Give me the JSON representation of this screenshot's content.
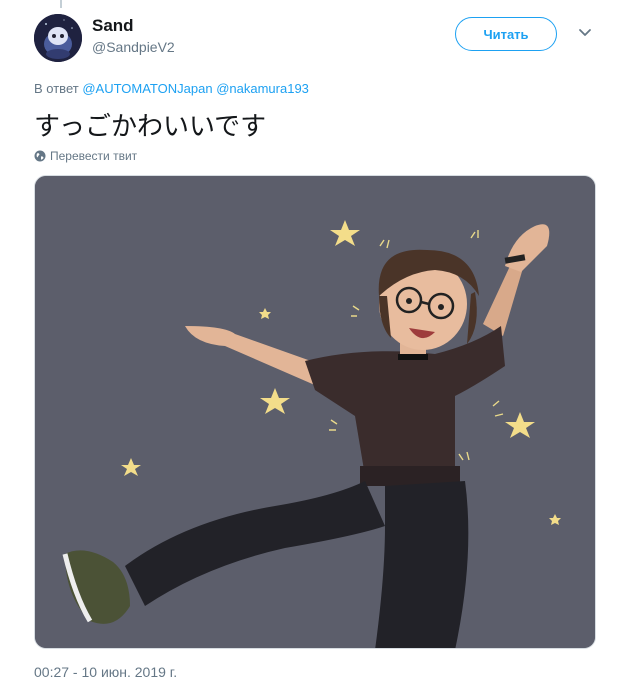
{
  "tweet": {
    "author": {
      "display_name": "Sand",
      "handle": "@SandpieV2"
    },
    "follow_label": "Читать",
    "reply": {
      "prefix": "В ответ",
      "mentions": [
        "@AUTOMATONJapan",
        "@nakamura193"
      ]
    },
    "text": "すっごかわいいです",
    "translate_label": "Перевести твит",
    "media": {
      "icon": "artwork-image",
      "background_color": "#5c5e6b"
    },
    "timestamp": "00:27 - 10 июн. 2019 г."
  },
  "colors": {
    "accent": "#1da1f2",
    "secondary_text": "#657786",
    "primary_text": "#14171a"
  }
}
